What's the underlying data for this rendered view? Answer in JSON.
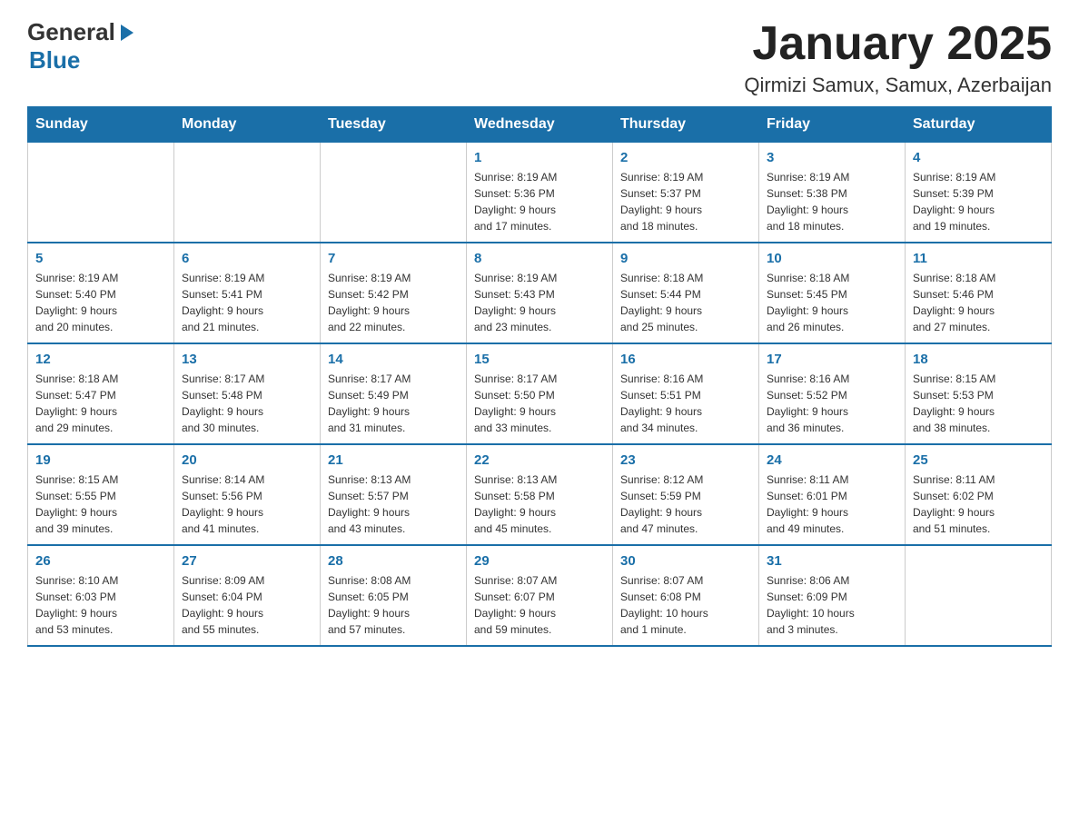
{
  "header": {
    "logo_general": "General",
    "logo_blue": "Blue",
    "title": "January 2025",
    "subtitle": "Qirmizi Samux, Samux, Azerbaijan"
  },
  "weekdays": [
    "Sunday",
    "Monday",
    "Tuesday",
    "Wednesday",
    "Thursday",
    "Friday",
    "Saturday"
  ],
  "weeks": [
    [
      {
        "day": "",
        "info": ""
      },
      {
        "day": "",
        "info": ""
      },
      {
        "day": "",
        "info": ""
      },
      {
        "day": "1",
        "info": "Sunrise: 8:19 AM\nSunset: 5:36 PM\nDaylight: 9 hours\nand 17 minutes."
      },
      {
        "day": "2",
        "info": "Sunrise: 8:19 AM\nSunset: 5:37 PM\nDaylight: 9 hours\nand 18 minutes."
      },
      {
        "day": "3",
        "info": "Sunrise: 8:19 AM\nSunset: 5:38 PM\nDaylight: 9 hours\nand 18 minutes."
      },
      {
        "day": "4",
        "info": "Sunrise: 8:19 AM\nSunset: 5:39 PM\nDaylight: 9 hours\nand 19 minutes."
      }
    ],
    [
      {
        "day": "5",
        "info": "Sunrise: 8:19 AM\nSunset: 5:40 PM\nDaylight: 9 hours\nand 20 minutes."
      },
      {
        "day": "6",
        "info": "Sunrise: 8:19 AM\nSunset: 5:41 PM\nDaylight: 9 hours\nand 21 minutes."
      },
      {
        "day": "7",
        "info": "Sunrise: 8:19 AM\nSunset: 5:42 PM\nDaylight: 9 hours\nand 22 minutes."
      },
      {
        "day": "8",
        "info": "Sunrise: 8:19 AM\nSunset: 5:43 PM\nDaylight: 9 hours\nand 23 minutes."
      },
      {
        "day": "9",
        "info": "Sunrise: 8:18 AM\nSunset: 5:44 PM\nDaylight: 9 hours\nand 25 minutes."
      },
      {
        "day": "10",
        "info": "Sunrise: 8:18 AM\nSunset: 5:45 PM\nDaylight: 9 hours\nand 26 minutes."
      },
      {
        "day": "11",
        "info": "Sunrise: 8:18 AM\nSunset: 5:46 PM\nDaylight: 9 hours\nand 27 minutes."
      }
    ],
    [
      {
        "day": "12",
        "info": "Sunrise: 8:18 AM\nSunset: 5:47 PM\nDaylight: 9 hours\nand 29 minutes."
      },
      {
        "day": "13",
        "info": "Sunrise: 8:17 AM\nSunset: 5:48 PM\nDaylight: 9 hours\nand 30 minutes."
      },
      {
        "day": "14",
        "info": "Sunrise: 8:17 AM\nSunset: 5:49 PM\nDaylight: 9 hours\nand 31 minutes."
      },
      {
        "day": "15",
        "info": "Sunrise: 8:17 AM\nSunset: 5:50 PM\nDaylight: 9 hours\nand 33 minutes."
      },
      {
        "day": "16",
        "info": "Sunrise: 8:16 AM\nSunset: 5:51 PM\nDaylight: 9 hours\nand 34 minutes."
      },
      {
        "day": "17",
        "info": "Sunrise: 8:16 AM\nSunset: 5:52 PM\nDaylight: 9 hours\nand 36 minutes."
      },
      {
        "day": "18",
        "info": "Sunrise: 8:15 AM\nSunset: 5:53 PM\nDaylight: 9 hours\nand 38 minutes."
      }
    ],
    [
      {
        "day": "19",
        "info": "Sunrise: 8:15 AM\nSunset: 5:55 PM\nDaylight: 9 hours\nand 39 minutes."
      },
      {
        "day": "20",
        "info": "Sunrise: 8:14 AM\nSunset: 5:56 PM\nDaylight: 9 hours\nand 41 minutes."
      },
      {
        "day": "21",
        "info": "Sunrise: 8:13 AM\nSunset: 5:57 PM\nDaylight: 9 hours\nand 43 minutes."
      },
      {
        "day": "22",
        "info": "Sunrise: 8:13 AM\nSunset: 5:58 PM\nDaylight: 9 hours\nand 45 minutes."
      },
      {
        "day": "23",
        "info": "Sunrise: 8:12 AM\nSunset: 5:59 PM\nDaylight: 9 hours\nand 47 minutes."
      },
      {
        "day": "24",
        "info": "Sunrise: 8:11 AM\nSunset: 6:01 PM\nDaylight: 9 hours\nand 49 minutes."
      },
      {
        "day": "25",
        "info": "Sunrise: 8:11 AM\nSunset: 6:02 PM\nDaylight: 9 hours\nand 51 minutes."
      }
    ],
    [
      {
        "day": "26",
        "info": "Sunrise: 8:10 AM\nSunset: 6:03 PM\nDaylight: 9 hours\nand 53 minutes."
      },
      {
        "day": "27",
        "info": "Sunrise: 8:09 AM\nSunset: 6:04 PM\nDaylight: 9 hours\nand 55 minutes."
      },
      {
        "day": "28",
        "info": "Sunrise: 8:08 AM\nSunset: 6:05 PM\nDaylight: 9 hours\nand 57 minutes."
      },
      {
        "day": "29",
        "info": "Sunrise: 8:07 AM\nSunset: 6:07 PM\nDaylight: 9 hours\nand 59 minutes."
      },
      {
        "day": "30",
        "info": "Sunrise: 8:07 AM\nSunset: 6:08 PM\nDaylight: 10 hours\nand 1 minute."
      },
      {
        "day": "31",
        "info": "Sunrise: 8:06 AM\nSunset: 6:09 PM\nDaylight: 10 hours\nand 3 minutes."
      },
      {
        "day": "",
        "info": ""
      }
    ]
  ]
}
